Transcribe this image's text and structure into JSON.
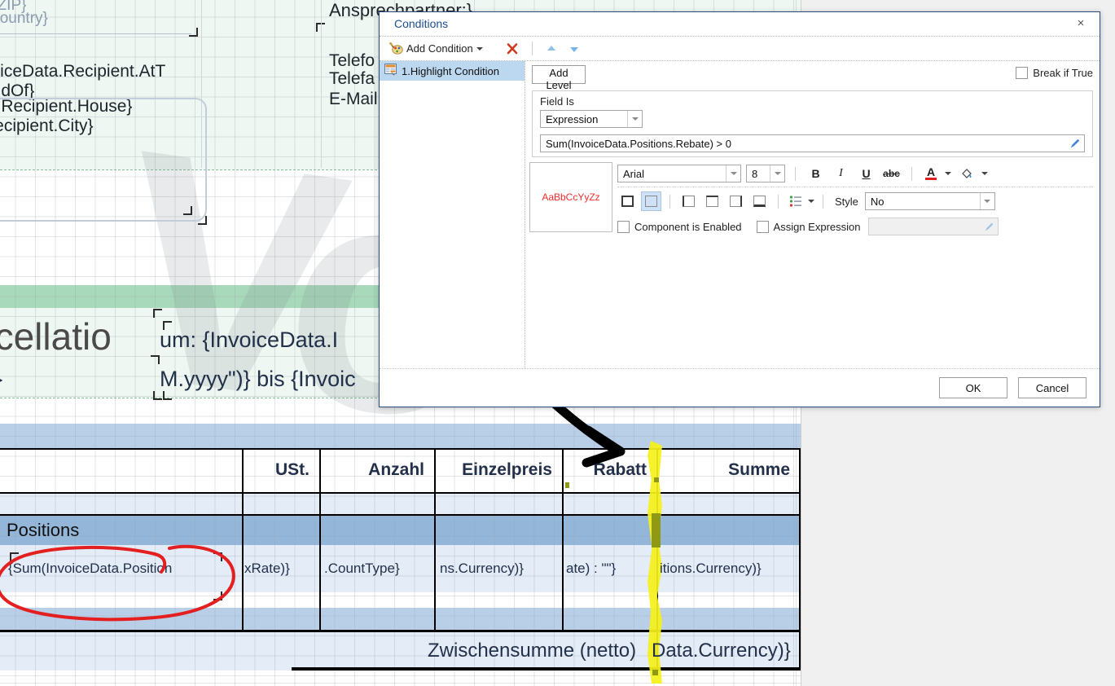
{
  "designer": {
    "report_texts": [
      {
        "id": "zip",
        "text": "r.ZIP}"
      },
      {
        "id": "country",
        "text": "Country}"
      },
      {
        "id": "attn",
        "text": "voiceData.Recipient.AtT"
      },
      {
        "id": "handof",
        "text": "andOf}"
      },
      {
        "id": "house",
        "text": "ta.Recipient.House}"
      },
      {
        "id": "city",
        "text": "Recipient.City}"
      },
      {
        "id": "contact",
        "text": "Ansprechpartner:}"
      },
      {
        "id": "phone",
        "text": "Telefo"
      },
      {
        "id": "fax",
        "text": "Telefa"
      },
      {
        "id": "email",
        "text": "E-Mail"
      },
      {
        "id": "cancel_hdr",
        "text": "ncellatio"
      },
      {
        "id": "date_line",
        "text": "um: {InvoiceData.I"
      },
      {
        "id": "brace",
        "text": "}"
      },
      {
        "id": "date_fmt",
        "text": "M.yyyy\")} bis {Invoic"
      }
    ],
    "watermark_text": "Vo",
    "table": {
      "column_headers": [
        "USt.",
        "Anzahl",
        "Einzelpreis",
        "Rabatt",
        "Summe"
      ],
      "group_label": "Positions",
      "data_cells": [
        "{Sum(InvoiceData.Position",
        "xRate)}",
        ".CountType}",
        "ns.Currency)}",
        "ate) : \"\"}",
        "itions.Currency)}"
      ],
      "footer_label": "Zwischensumme (netto)",
      "footer_value": "Data.Currency)}"
    },
    "annotations": {
      "highlight_color": "#f5f11a",
      "circle_color": "#e41f1f",
      "arrow_color": "#000000"
    }
  },
  "dialog": {
    "title": "Conditions",
    "close_label": "×",
    "toolbar": {
      "add_condition_label": "Add Condition",
      "delete_title": "Delete",
      "move_up_title": "Move Up",
      "move_down_title": "Move Down"
    },
    "conditions_list": [
      {
        "label": "1.Highlight Condition",
        "selected": true
      }
    ],
    "add_level_label": "Add Level",
    "break_if_true": {
      "label": "Break if True",
      "checked": false
    },
    "field_is": {
      "legend": "Field Is",
      "type_value": "Expression",
      "expression_value": "Sum(InvoiceData.Positions.Rebate) > 0"
    },
    "format": {
      "preview_text": "AaBbCcYyZz",
      "preview_color": "#ff2a2a",
      "font_family_value": "Arial",
      "font_size_value": "8",
      "bold_label": "B",
      "italic_label": "I",
      "underline_label": "U",
      "strike_label": "abc",
      "font_color_label": "A",
      "font_color_swatch": "#e02020",
      "highlight_color_swatch": "#1e90ff",
      "border_buttons": [
        "border-all",
        "border-none",
        "border-left",
        "border-top",
        "border-right",
        "border-bottom"
      ],
      "selected_border_index": 1,
      "style_label": "Style",
      "style_value": "No"
    },
    "component_is_enabled": {
      "label": "Component is Enabled",
      "checked": false
    },
    "assign_expression": {
      "label": "Assign Expression",
      "checked": false,
      "value": ""
    },
    "buttons": {
      "ok": "OK",
      "cancel": "Cancel"
    }
  }
}
